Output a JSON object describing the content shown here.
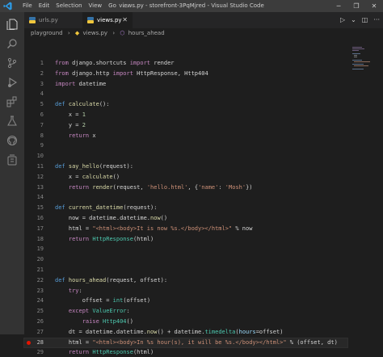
{
  "titlebar": {
    "menu": [
      "File",
      "Edit",
      "Selection",
      "View",
      "Go",
      "..."
    ],
    "title": "views.py - storefront-3PqMjred - Visual Studio Code"
  },
  "tabs": [
    {
      "label": "urls.py",
      "active": false
    },
    {
      "label": "views.py",
      "active": true
    }
  ],
  "breadcrumb": {
    "folder": "playground",
    "file": "views.py",
    "symbol": "hours_ahead"
  },
  "editor": {
    "current_line": 28,
    "breakpoint_line": 28,
    "lines": [
      {
        "n": "1",
        "html": "<span class=\"kw\">from</span> django.shortcuts <span class=\"kw\">import</span> render"
      },
      {
        "n": "2",
        "html": "<span class=\"kw\">from</span> django.http <span class=\"kw\">import</span> HttpResponse, Http404"
      },
      {
        "n": "3",
        "html": "<span class=\"kw\">import</span> datetime"
      },
      {
        "n": "4",
        "html": ""
      },
      {
        "n": "5",
        "html": "<span class=\"kw2\">def</span> <span class=\"fn\">calculate</span>():"
      },
      {
        "n": "6",
        "html": "    x = <span class=\"num\">1</span>"
      },
      {
        "n": "7",
        "html": "    y = <span class=\"num\">2</span>"
      },
      {
        "n": "8",
        "html": "    <span class=\"kw\">return</span> x"
      },
      {
        "n": "9",
        "html": ""
      },
      {
        "n": "10",
        "html": ""
      },
      {
        "n": "11",
        "html": "<span class=\"kw2\">def</span> <span class=\"fn\">say_hello</span>(request):"
      },
      {
        "n": "12",
        "html": "    x = <span class=\"fn\">calculate</span>()"
      },
      {
        "n": "13",
        "html": "    <span class=\"kw\">return</span> <span class=\"fn\">render</span>(request, <span class=\"str\">'hello.html'</span>, {<span class=\"str\">'name'</span>: <span class=\"str\">'Mosh'</span>})"
      },
      {
        "n": "14",
        "html": ""
      },
      {
        "n": "15",
        "html": "<span class=\"kw2\">def</span> <span class=\"fn\">current_datetime</span>(request):"
      },
      {
        "n": "16",
        "html": "    now = datetime.datetime.<span class=\"fn\">now</span>()"
      },
      {
        "n": "17",
        "html": "    html = <span class=\"str\">\"&lt;html&gt;&lt;body&gt;It is now %s.&lt;/body&gt;&lt;/html&gt;\"</span> % now"
      },
      {
        "n": "18",
        "html": "    <span class=\"kw\">return</span> <span class=\"cls\">HttpResponse</span>(html)"
      },
      {
        "n": "19",
        "html": ""
      },
      {
        "n": "20",
        "html": ""
      },
      {
        "n": "21",
        "html": ""
      },
      {
        "n": "22",
        "html": "<span class=\"kw2\">def</span> <span class=\"fn\">hours_ahead</span>(request, offset):"
      },
      {
        "n": "23",
        "html": "    <span class=\"kw\">try</span>:"
      },
      {
        "n": "24",
        "html": "        offset = <span class=\"cls\">int</span>(offset)"
      },
      {
        "n": "25",
        "html": "    <span class=\"kw\">except</span> <span class=\"cls\">ValueError</span>:"
      },
      {
        "n": "26",
        "html": "        <span class=\"kw\">raise</span> <span class=\"cls\">Http404</span>()"
      },
      {
        "n": "27",
        "html": "    dt = datetime.datetime.<span class=\"fn\">now</span>() + datetime.<span class=\"cls\">timedelta</span>(<span class=\"param\">hours</span>=offset)"
      },
      {
        "n": "28",
        "html": "    html = <span class=\"str\">\"&lt;html&gt;&lt;body&gt;In %s hour(s), it will be %s.&lt;/body&gt;&lt;/html&gt;\"</span> % (offset, dt)"
      },
      {
        "n": "29",
        "html": "    <span class=\"kw\">return</span> <span class=\"cls\">HttpResponse</span>(html)"
      }
    ]
  }
}
